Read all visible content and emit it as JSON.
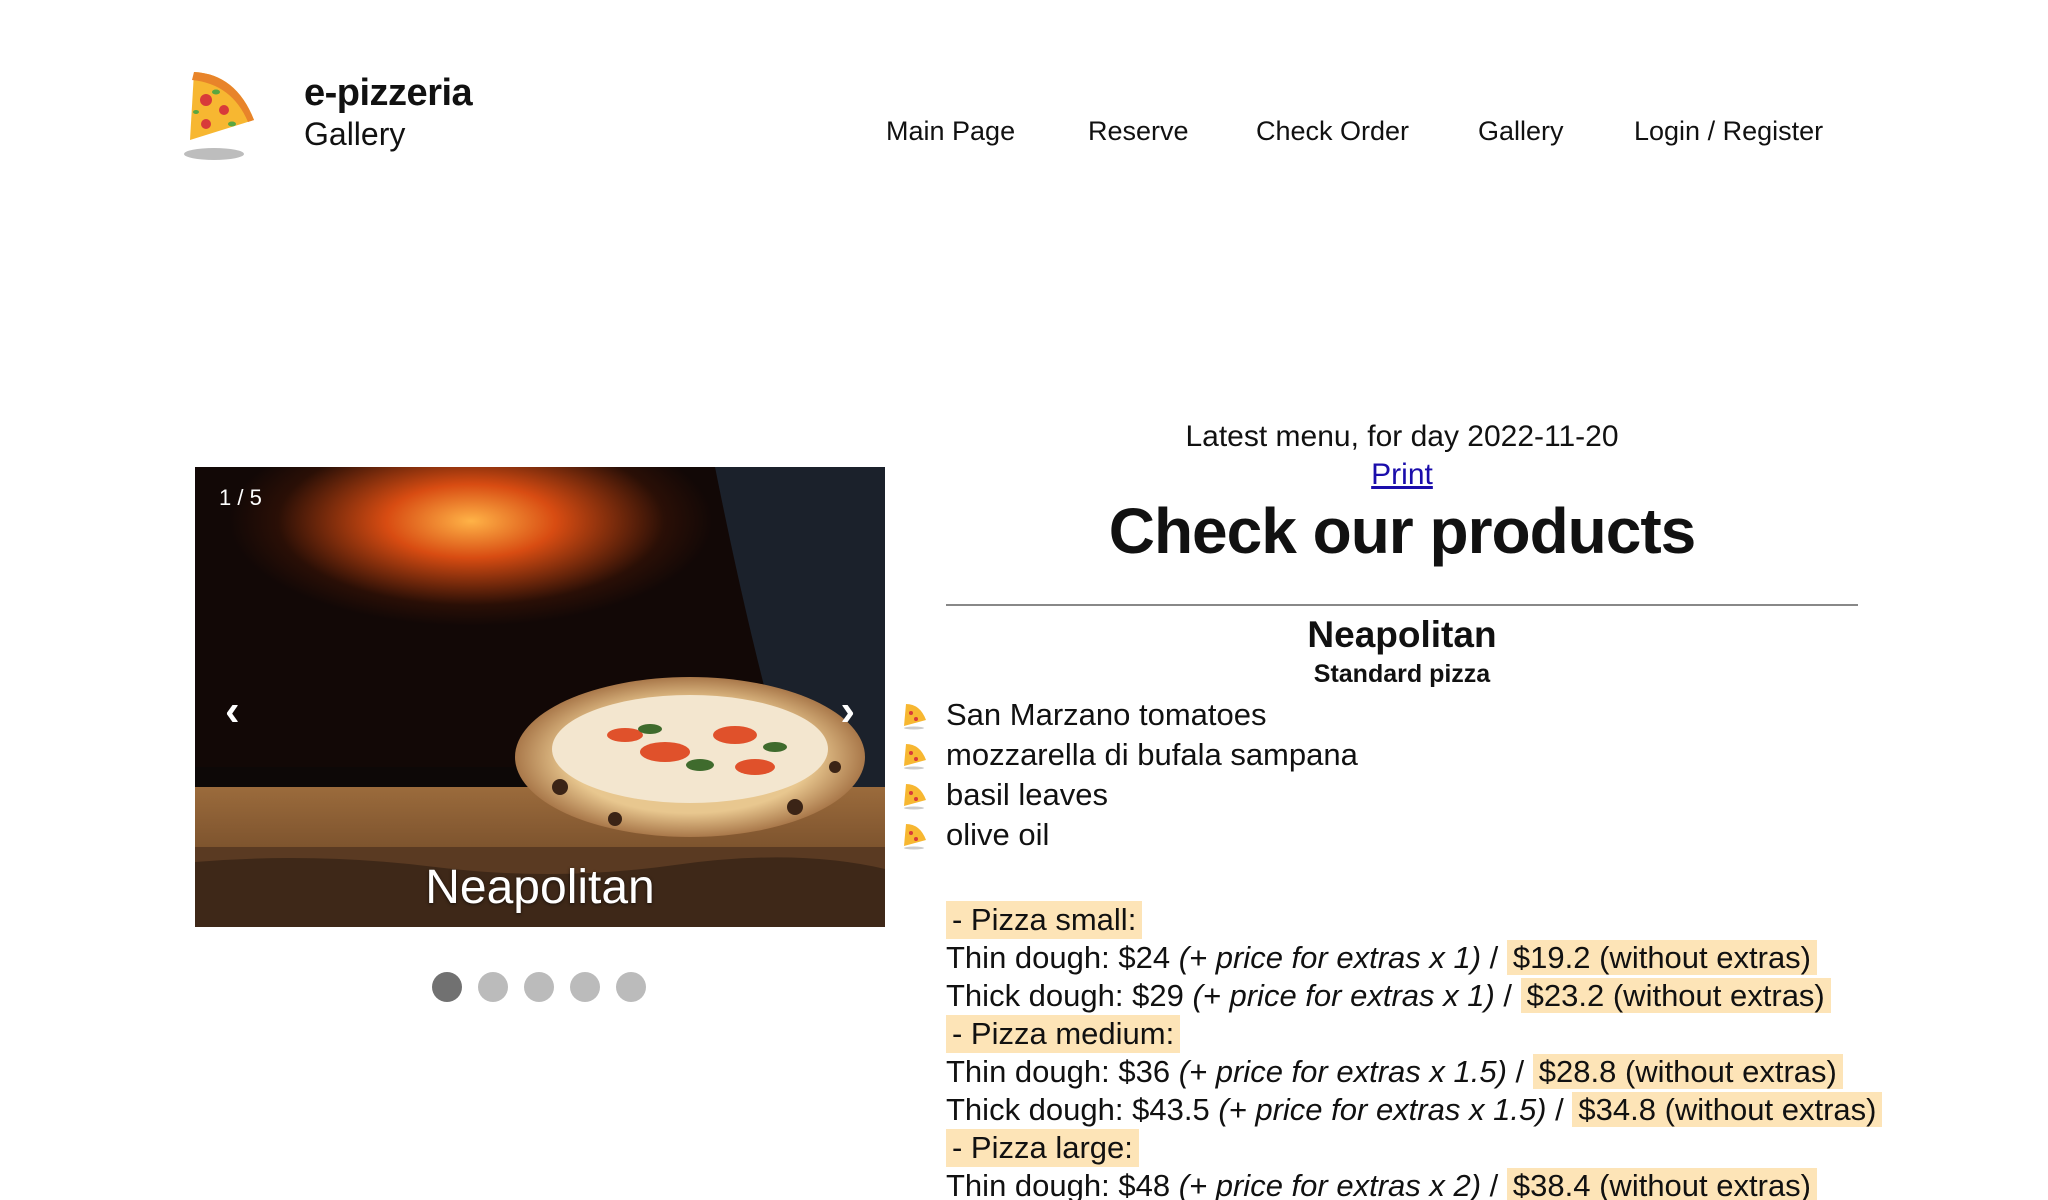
{
  "header": {
    "brand_title": "e-pizzeria",
    "brand_subtitle": "Gallery",
    "nav": [
      "Main Page",
      "Reserve",
      "Check Order",
      "Gallery",
      "Login / Register"
    ]
  },
  "carousel": {
    "counter": "1 / 5",
    "prev_label": "‹",
    "next_label": "›",
    "caption": "Neapolitan",
    "slides_total": 5,
    "active_index": 0
  },
  "menu": {
    "date_text": "Latest menu, for day 2022-11-20",
    "print_label": "Print",
    "heading": "Check our products",
    "product": {
      "name": "Neapolitan",
      "type": "Standard pizza",
      "ingredients": [
        "San Marzano tomatoes",
        "mozzarella di bufala sampana",
        "basil leaves",
        "olive oil"
      ],
      "sizes": [
        {
          "label": "- Pizza small:",
          "rows": [
            {
              "dough": "Thin dough: $24",
              "extras": "(+ price for extras x 1)",
              "sep": "/",
              "base": "$19.2 (without extras)"
            },
            {
              "dough": "Thick dough: $29",
              "extras": "(+ price for extras x 1)",
              "sep": "/",
              "base": "$23.2 (without extras)"
            }
          ]
        },
        {
          "label": "- Pizza medium:",
          "rows": [
            {
              "dough": "Thin dough: $36",
              "extras": "(+ price for extras x 1.5)",
              "sep": "/",
              "base": "$28.8 (without extras)"
            },
            {
              "dough": "Thick dough: $43.5",
              "extras": "(+ price for extras x 1.5)",
              "sep": "/",
              "base": "$34.8 (without extras)"
            }
          ]
        },
        {
          "label": "- Pizza large:",
          "rows": [
            {
              "dough": "Thin dough: $48",
              "extras": "(+ price for extras x 2)",
              "sep": "/",
              "base": "$38.4 (without extras)"
            }
          ]
        }
      ]
    }
  },
  "colors": {
    "highlight": "#fde4b7",
    "link": "#1a0dab",
    "dot_active": "#717171",
    "dot_inactive": "#bbbbbb"
  },
  "icons": {
    "logo": "pizza-slice-icon",
    "bullet": "pizza-bullet-icon"
  }
}
